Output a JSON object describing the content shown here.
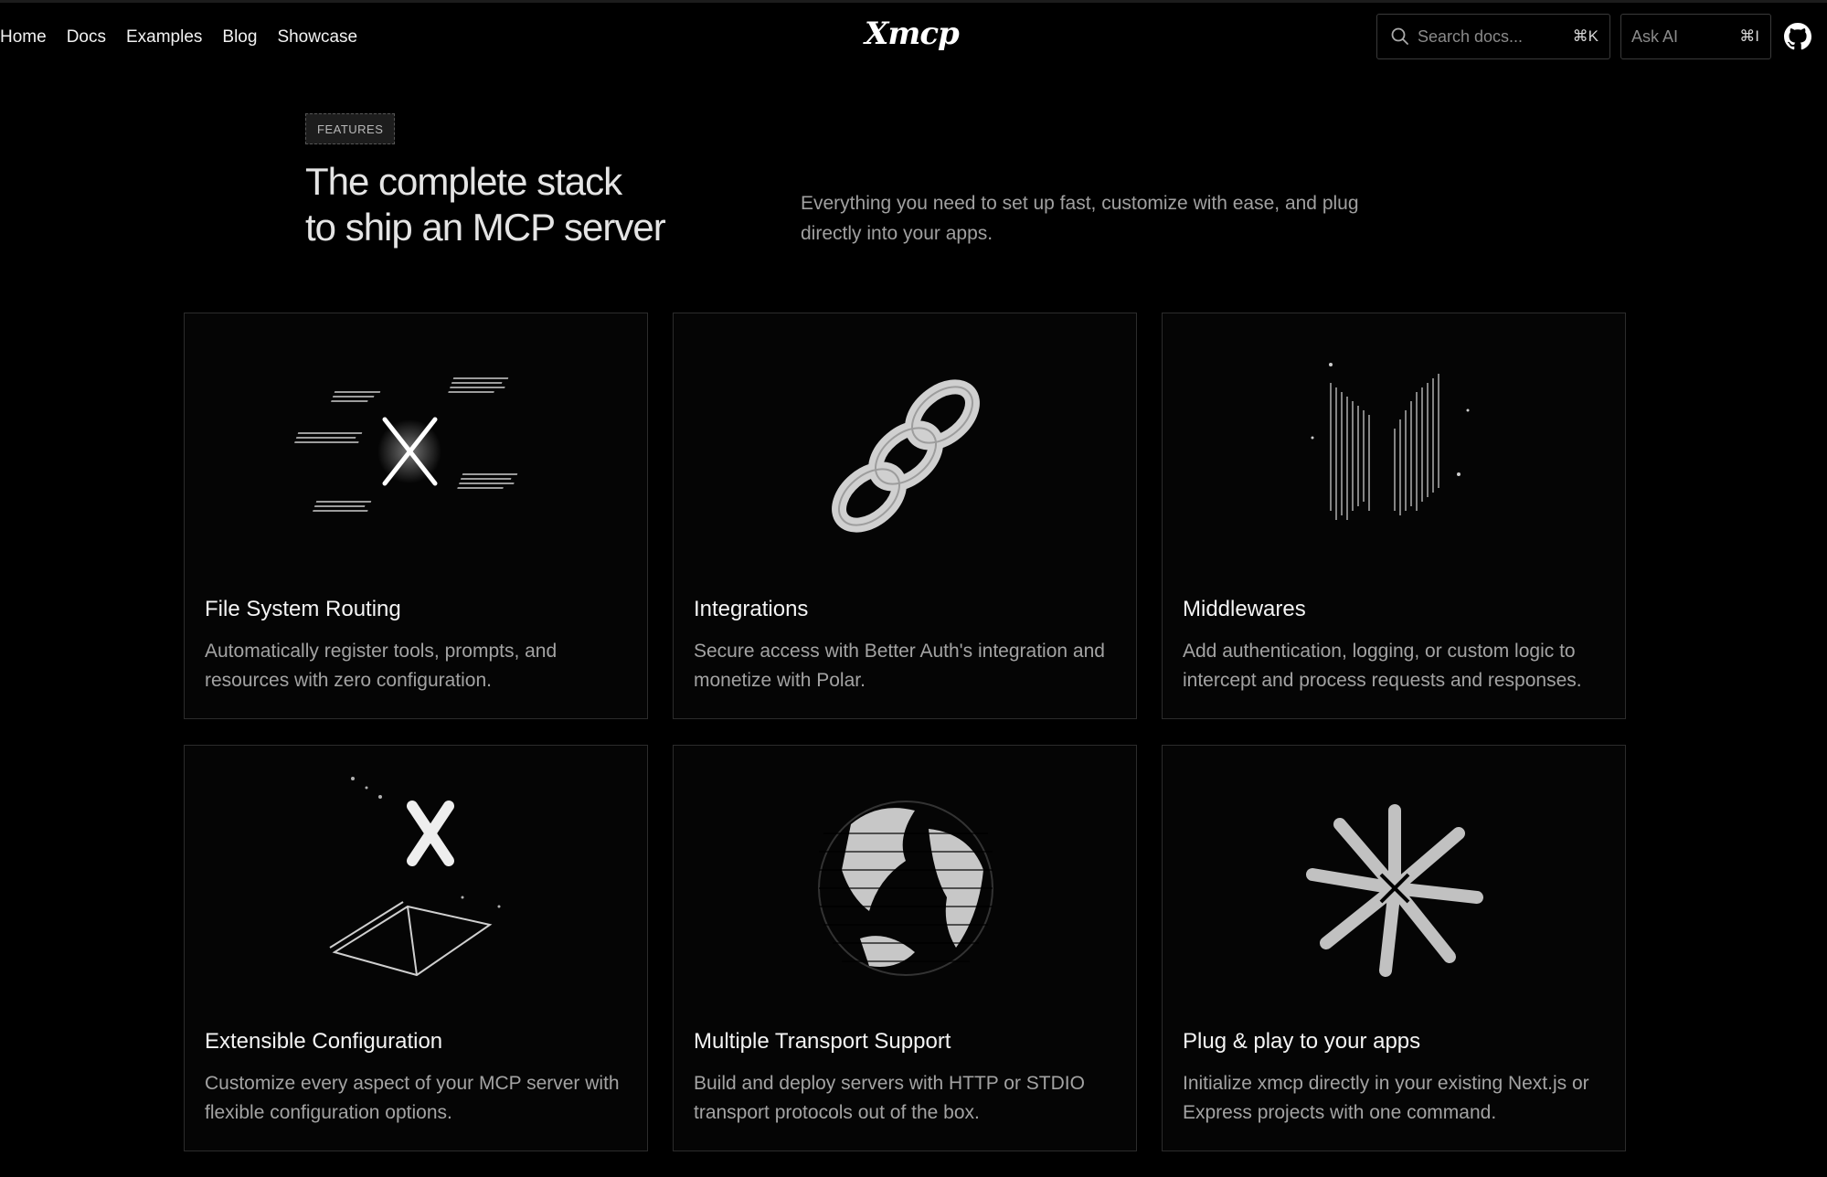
{
  "nav": {
    "links": [
      "Home",
      "Docs",
      "Examples",
      "Blog",
      "Showcase"
    ],
    "logo": "Xmcp"
  },
  "search": {
    "placeholder": "Search docs...",
    "shortcut": "⌘K",
    "icon": "search-icon"
  },
  "ask_ai": {
    "placeholder": "Ask AI",
    "shortcut": "⌘I"
  },
  "github_icon": "github-icon",
  "hero": {
    "badge": "FEATURES",
    "headline_line1": "The complete stack",
    "headline_line2": "to ship an MCP server",
    "subtitle": "Everything you need to set up fast, customize with ease, and plug directly into your apps."
  },
  "features": [
    {
      "title": "File System Routing",
      "description": "Automatically register tools, prompts, and resources with zero configuration.",
      "icon": "file-routing-art"
    },
    {
      "title": "Integrations",
      "description": "Secure access with Better Auth's integration and monetize with Polar.",
      "icon": "chain-link-art"
    },
    {
      "title": "Middlewares",
      "description": "Add authentication, logging, or custom logic to intercept and process requests and responses.",
      "icon": "layers-art"
    },
    {
      "title": "Extensible Configuration",
      "description": "Customize every aspect of your MCP server with flexible configuration options.",
      "icon": "config-book-art"
    },
    {
      "title": "Multiple Transport Support",
      "description": "Build and deploy servers with HTTP or STDIO transport protocols out of the box.",
      "icon": "globe-art"
    },
    {
      "title": "Plug & play to your apps",
      "description": "Initialize xmcp directly in your existing Next.js or Express projects with one command.",
      "icon": "starburst-art"
    }
  ],
  "colors": {
    "background": "#000000",
    "card_border": "#2c2c2c",
    "muted_text": "#a3a3a3"
  }
}
